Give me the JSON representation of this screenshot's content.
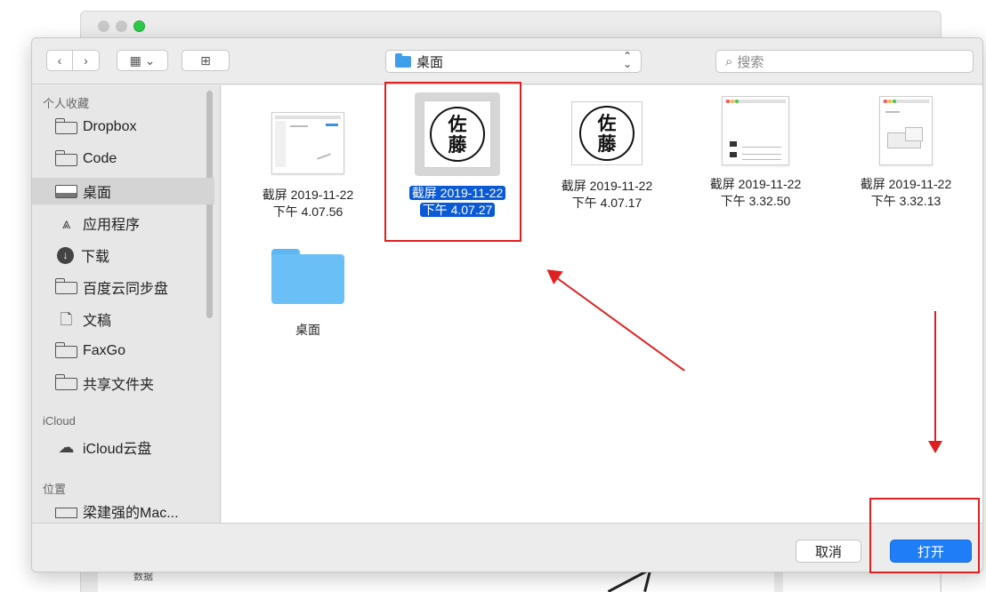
{
  "dialog": {
    "location": "桌面",
    "search_placeholder": "搜索"
  },
  "toolbar": {
    "back_glyph": "‹",
    "forward_glyph": "›",
    "view_glyph": "▦ ⌄",
    "new_folder_glyph": "⊞"
  },
  "sidebar": {
    "favorites_header": "个人收藏",
    "favorites": [
      {
        "label": "Dropbox",
        "icon": "folder-icon"
      },
      {
        "label": "Code",
        "icon": "folder-icon"
      },
      {
        "label": "桌面",
        "icon": "desktop-icon",
        "selected": true
      },
      {
        "label": "应用程序",
        "icon": "applications-icon"
      },
      {
        "label": "下载",
        "icon": "download-icon"
      },
      {
        "label": "百度云同步盘",
        "icon": "folder-icon"
      },
      {
        "label": "文稿",
        "icon": "document-icon"
      },
      {
        "label": "FaxGo",
        "icon": "folder-icon"
      },
      {
        "label": "共享文件夹",
        "icon": "folder-icon"
      }
    ],
    "icloud_header": "iCloud",
    "icloud": [
      {
        "label": "iCloud云盘",
        "icon": "cloud-icon"
      }
    ],
    "locations_header": "位置",
    "locations": [
      {
        "label": "梁建强的Mac...",
        "icon": "computer-icon"
      }
    ]
  },
  "files": [
    {
      "line1": "截屏 2019-11-22",
      "line2": "下午 4.07.56",
      "kind": "screenshot"
    },
    {
      "line1": "截屏 2019-11-22",
      "line2": "下午 4.07.27",
      "kind": "seal",
      "selected": true
    },
    {
      "line1": "截屏 2019-11-22",
      "line2": "下午 4.07.17",
      "kind": "seal"
    },
    {
      "line1": "截屏 2019-11-22",
      "line2": "下午 3.32.50",
      "kind": "screenshot"
    },
    {
      "line1": "截屏 2019-11-22",
      "line2": "下午 3.32.13",
      "kind": "screenshot"
    },
    {
      "line1": "桌面",
      "line2": "",
      "kind": "folder"
    }
  ],
  "seal_text": [
    "佐",
    "藤"
  ],
  "buttons": {
    "cancel": "取消",
    "open": "打开"
  },
  "background": {
    "text": "数据"
  },
  "colors": {
    "accent": "#1f7ef7",
    "selection": "#0a5ad6",
    "annotation": "#e02020"
  }
}
